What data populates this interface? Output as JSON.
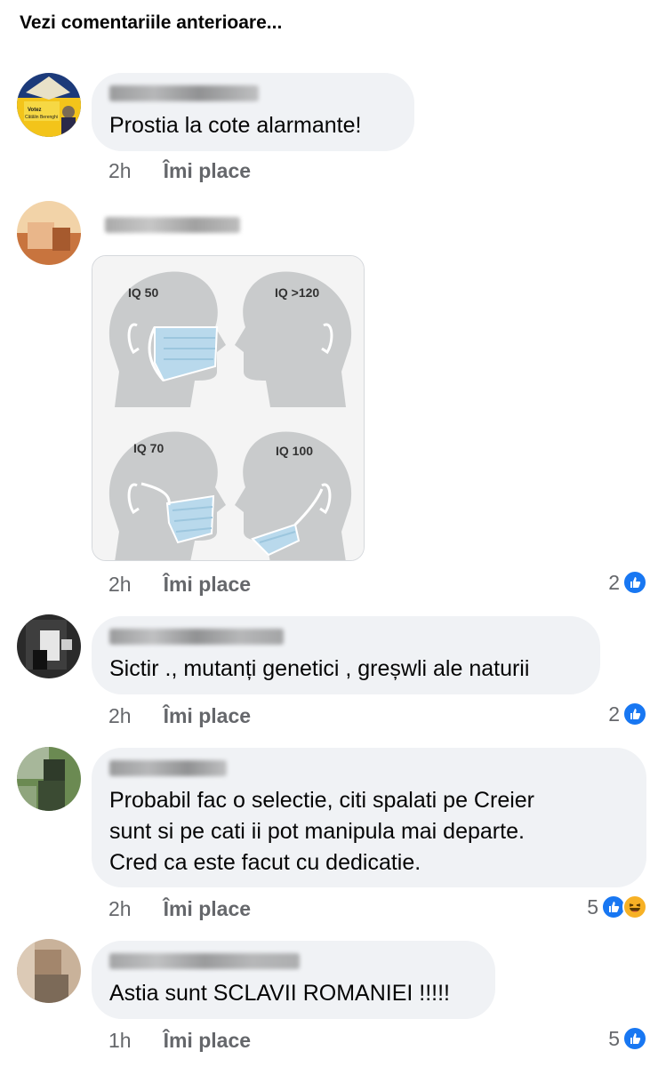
{
  "header": {
    "see_previous": "Vezi comentariile anterioare..."
  },
  "colors": {
    "bubble": "#f0f2f5",
    "meta_text": "#65676b",
    "like_blue": "#1877f2",
    "haha_yellow": "#f7b125"
  },
  "comments": [
    {
      "text": "Prostia la cote alarmante!",
      "time": "2h",
      "like_label": "Îmi place",
      "reactions": ""
    },
    {
      "text": "",
      "time": "2h",
      "like_label": "Îmi place",
      "reactions": "2",
      "image": {
        "labels": [
          "IQ 50",
          "IQ >120",
          "IQ 70",
          "IQ 100"
        ]
      }
    },
    {
      "text": "Sictir ., mutanți genetici , greșwli ale naturii",
      "time": "2h",
      "like_label": "Îmi place",
      "reactions": "2"
    },
    {
      "lines": [
        "Probabil fac o selectie, citi spalati pe Creier",
        "sunt si pe cati ii pot manipula mai departe.",
        "Cred ca este facut cu dedicatie."
      ],
      "time": "2h",
      "like_label": "Îmi place",
      "reactions": "5"
    },
    {
      "text": "Astia sunt SCLAVII ROMANIEI !!!!!",
      "time": "1h",
      "like_label": "Îmi place",
      "reactions": "5"
    }
  ],
  "avatars": {
    "a1": {
      "badge_line1": "Votez",
      "badge_line2": "Cătălin Berenghi"
    }
  }
}
